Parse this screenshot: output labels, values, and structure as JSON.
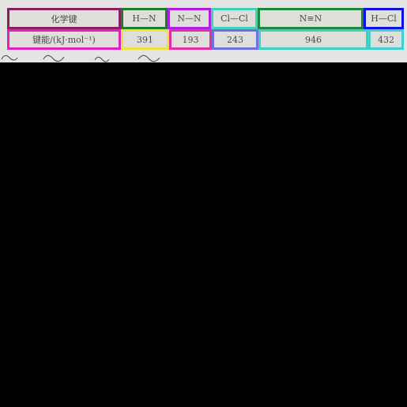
{
  "table": {
    "header": {
      "row_label": "化学键",
      "bonds": [
        "H—N",
        "N—N",
        "Cl—Cl",
        "N≡N",
        "H—Cl"
      ]
    },
    "values": {
      "row_label": "键能/(kJ·mol⁻¹)",
      "energies": [
        "391",
        "193",
        "243",
        "946",
        "432"
      ]
    }
  },
  "colors": {
    "row_label_header": "#8a2060",
    "row_label_values": "#e020c0",
    "bond_0": "#1f7a2a",
    "bond_1": "#b020e0",
    "bond_2": "#40d0c0",
    "bond_3": "#1a8a3a",
    "bond_4": "#1010e0",
    "energy_0": "#f0e040",
    "energy_1": "#e030a0",
    "energy_2": "#7070e0",
    "energy_3": "#40d0c0",
    "energy_4": "#40d0d0"
  }
}
